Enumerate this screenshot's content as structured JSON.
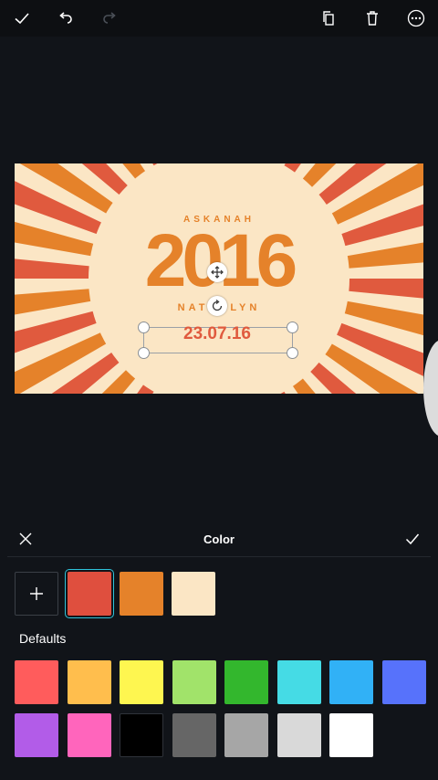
{
  "toolbar": {
    "icons": [
      "check-icon",
      "undo-icon",
      "redo-icon",
      "duplicate-icon",
      "trash-icon",
      "more-icon"
    ]
  },
  "design": {
    "top_text": "ASKANAH",
    "year": "2016",
    "bottom_text": "NATHALYN",
    "date": "23.07.16",
    "colors": {
      "red": "#e05a3e",
      "orange": "#e5822a",
      "cream": "#fbe6c5"
    }
  },
  "color_panel": {
    "title": "Color",
    "defaults_label": "Defaults",
    "document_colors": [
      "#df4f3e",
      "#e5822a",
      "#fbe6c5"
    ],
    "selected_document_color": 0,
    "default_colors": [
      [
        "#ff5c5c",
        "#ffbe4d",
        "#fef650",
        "#a1e36a",
        "#33b72d",
        "#45dbe5",
        "#31b1f6",
        "#5772fb"
      ],
      [
        "#b25ce8",
        "#ff65bc",
        "#000000",
        "#666666",
        "#a6a6a6",
        "#d9d9d9",
        "#ffffff"
      ]
    ]
  }
}
